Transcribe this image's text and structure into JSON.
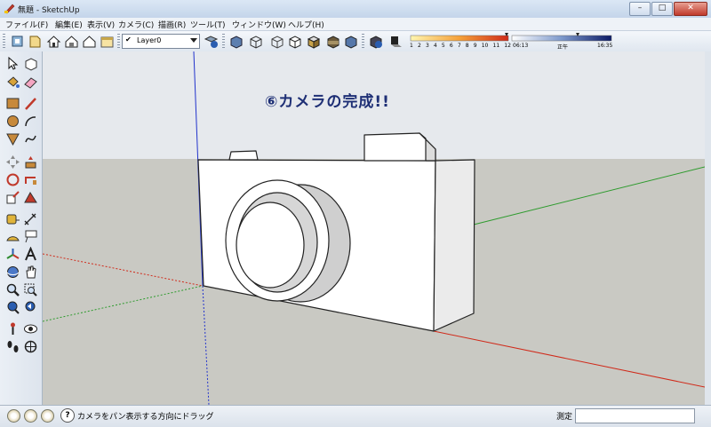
{
  "window": {
    "title": "無題 - SketchUp",
    "controls": {
      "minimize": "–",
      "maximize": "□",
      "close": "✕"
    }
  },
  "menu": [
    "ファイル(F)",
    "編集(E)",
    "表示(V)",
    "カメラ(C)",
    "描画(R)",
    "ツール(T)",
    "ウィンドウ(W)",
    "ヘルプ(H)"
  ],
  "toolbar": {
    "layer": {
      "check": "✔",
      "value": "Layer0"
    },
    "shadow": {
      "months": [
        "1",
        "2",
        "3",
        "4",
        "5",
        "6",
        "7",
        "8",
        "9",
        "10",
        "11",
        "12"
      ],
      "time_start": "06:13",
      "time_noon": "正午",
      "time_end": "16:35"
    }
  },
  "canvas": {
    "caption": "⑥カメラの完成!!",
    "colors": {
      "sky": "#e6e9ed",
      "ground": "#c9c9c3",
      "model_face": "#ffffff",
      "model_side": "#e8e8e8",
      "edge": "#222222"
    }
  },
  "status": {
    "help": "?",
    "hint": "カメラをパン表示する方向にドラッグ",
    "measure_label": "測定",
    "measure_value": ""
  },
  "icons": [
    "sketchup-logo-icon",
    "new-file-icon",
    "open-file-icon",
    "home-icon",
    "layer-manager-icon",
    "xray-icon",
    "wireframe-icon",
    "shaded-icon",
    "monochrome-icon",
    "shadow-settings-icon",
    "select-icon",
    "eraser-icon",
    "paint-bucket-icon",
    "rectangle-icon",
    "line-icon",
    "circle-icon",
    "arc-icon",
    "push-pull-icon",
    "move-icon",
    "rotate-icon",
    "scale-icon",
    "offset-icon",
    "tape-measure-icon",
    "dimension-icon",
    "protractor-icon",
    "text-icon",
    "axes-icon",
    "3d-text-icon",
    "orbit-icon",
    "pan-icon",
    "zoom-icon",
    "zoom-window-icon",
    "previous-view-icon",
    "next-view-icon",
    "walk-icon",
    "look-around-icon",
    "position-camera-icon",
    "section-plane-icon"
  ]
}
